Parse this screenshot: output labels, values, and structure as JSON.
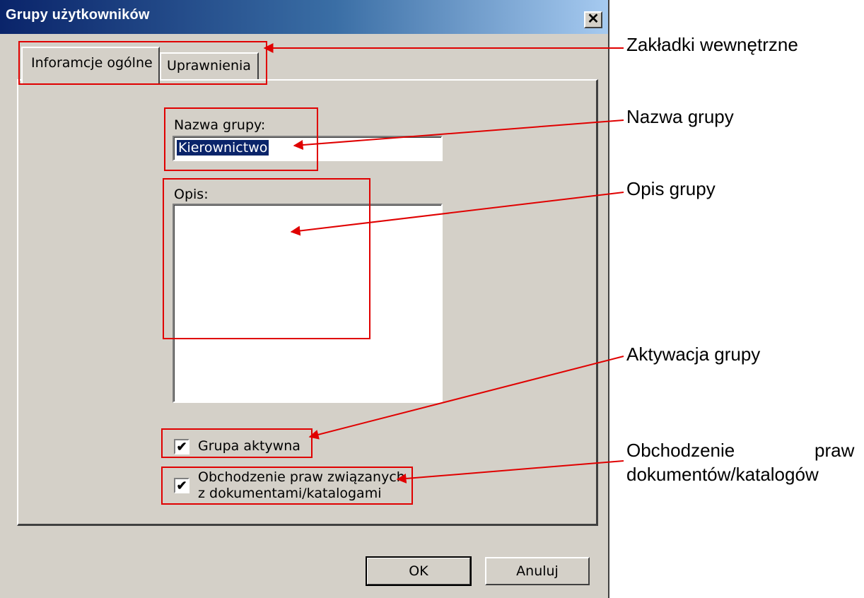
{
  "window": {
    "title": "Grupy użytkowników",
    "close_glyph": "✕"
  },
  "tabs": [
    {
      "label": "Inforamcje ogólne",
      "active": true
    },
    {
      "label": "Uprawnienia",
      "active": false
    }
  ],
  "form": {
    "group_name_label": "Nazwa grupy:",
    "group_name_value": "Kierownictwo",
    "description_label": "Opis:",
    "description_value": "",
    "active_checkbox": {
      "label": "Grupa aktywna",
      "checked": true,
      "glyph": "✔"
    },
    "bypass_checkbox": {
      "label_line1": "Obchodzenie praw związanych",
      "label_line2": "z dokumentami/katalogami",
      "checked": true,
      "glyph": "✔"
    }
  },
  "buttons": {
    "ok": "OK",
    "cancel": "Anuluj"
  },
  "annotations": {
    "tabs": "Zakładki wewnętrzne",
    "group_name": "Nazwa grupy",
    "description": "Opis grupy",
    "activation": "Aktywacja grupy",
    "bypass_line1_left": "Obchodzenie",
    "bypass_line1_right": "praw",
    "bypass_line2": "dokumentów/katalogów"
  },
  "colors": {
    "annotation_red": "#e00000",
    "title_gradient_start": "#0a246a",
    "dialog_bg": "#d4d0c8"
  }
}
